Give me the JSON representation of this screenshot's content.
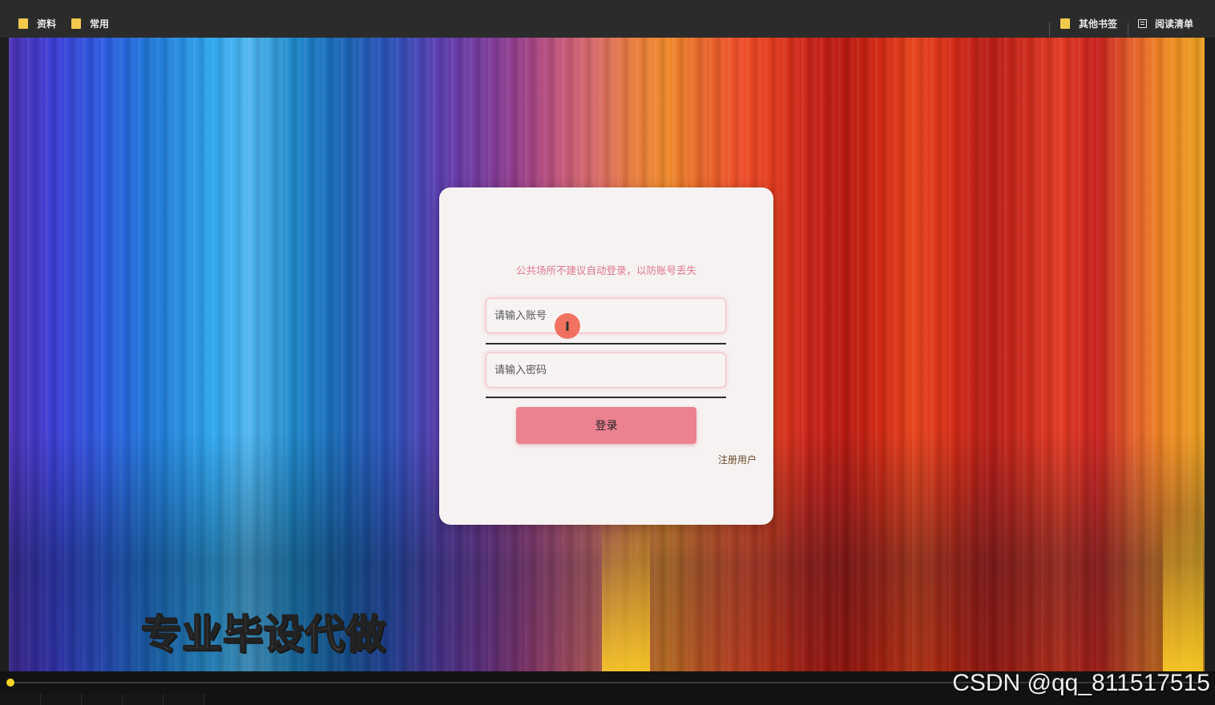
{
  "browser": {
    "bookmarks_left": [
      {
        "label": "资料",
        "icon": "folder-icon"
      },
      {
        "label": "常用",
        "icon": "folder-icon"
      }
    ],
    "bookmarks_right": [
      {
        "label": "其他书签",
        "icon": "folder-icon"
      },
      {
        "label": "阅读清单",
        "icon": "reading-list-icon"
      }
    ]
  },
  "login": {
    "notice": "公共场所不建议自动登录，以防账号丢失",
    "account_placeholder": "请输入账号",
    "password_placeholder": "请输入密码",
    "login_button": "登录",
    "register_link": "注册用户"
  },
  "overlay": {
    "banner_text": "专业毕设代做",
    "watermark": "CSDN @qq_811517515"
  },
  "colors": {
    "accent": "#ec8190",
    "notice_text": "#e0788a",
    "card_bg": "#f6f2f2"
  }
}
